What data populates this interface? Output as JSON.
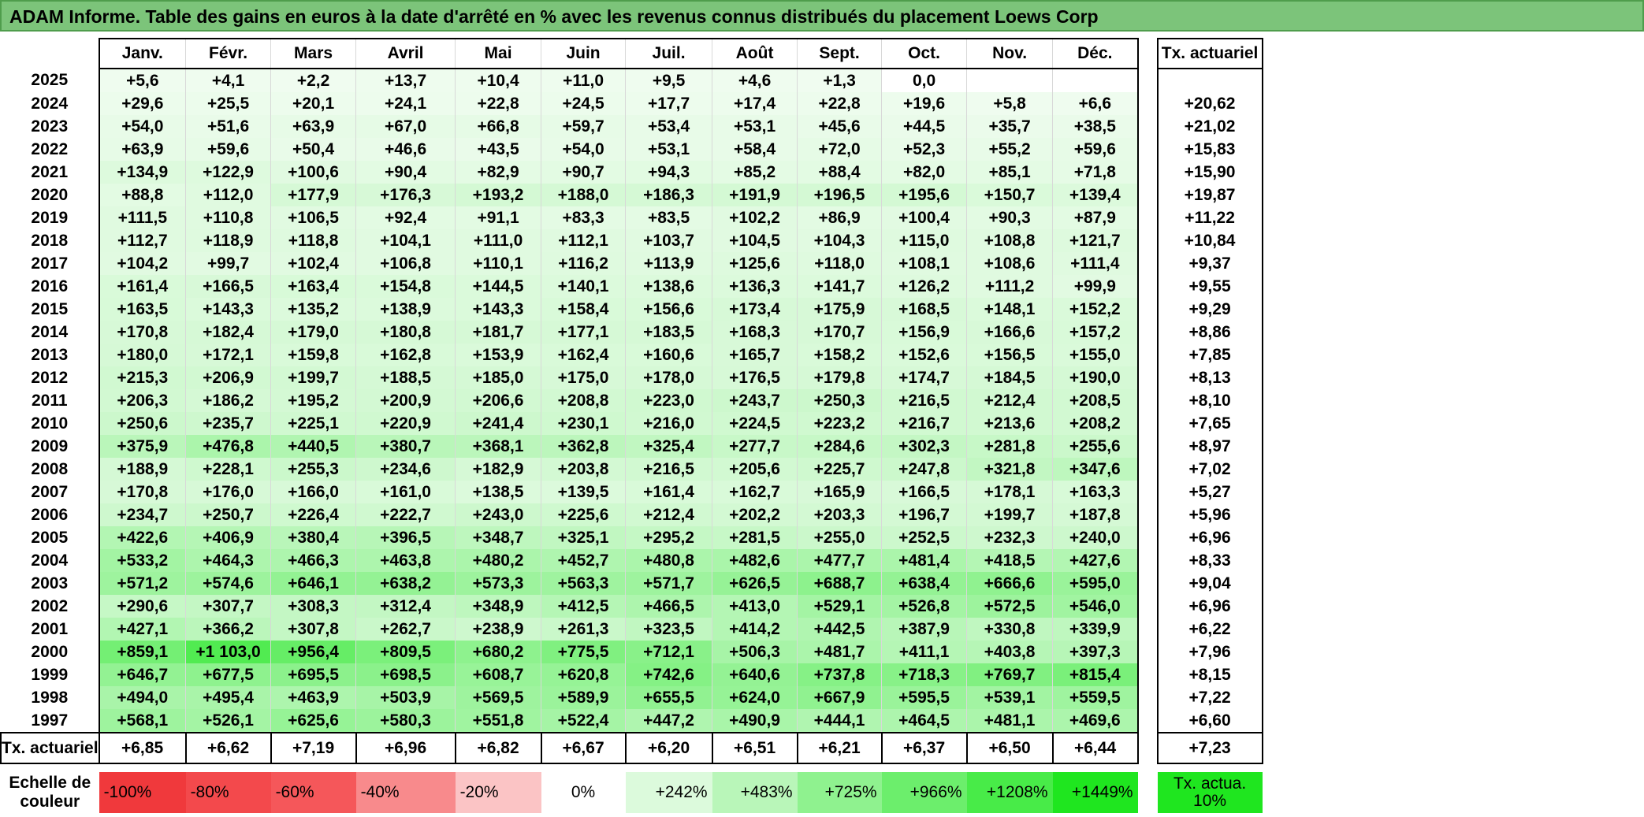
{
  "title": "ADAM Informe. Table des gains en euros à la date d'arrêté en % avec les revenus connus distribués du placement Loews Corp",
  "months": [
    "Janv.",
    "Févr.",
    "Mars",
    "Avril",
    "Mai",
    "Juin",
    "Juil.",
    "Août",
    "Sept.",
    "Oct.",
    "Nov.",
    "Déc."
  ],
  "actuarial_header": "Tx. actuariel",
  "rows": [
    {
      "year": "2025",
      "values": [
        "+5,6",
        "+4,1",
        "+2,2",
        "+13,7",
        "+10,4",
        "+11,0",
        "+9,5",
        "+4,6",
        "+1,3",
        "0,0",
        "",
        ""
      ],
      "actuarial": ""
    },
    {
      "year": "2024",
      "values": [
        "+29,6",
        "+25,5",
        "+20,1",
        "+24,1",
        "+22,8",
        "+24,5",
        "+17,7",
        "+17,4",
        "+22,8",
        "+19,6",
        "+5,8",
        "+6,6"
      ],
      "actuarial": "+20,62"
    },
    {
      "year": "2023",
      "values": [
        "+54,0",
        "+51,6",
        "+63,9",
        "+67,0",
        "+66,8",
        "+59,7",
        "+53,4",
        "+53,1",
        "+45,6",
        "+44,5",
        "+35,7",
        "+38,5"
      ],
      "actuarial": "+21,02"
    },
    {
      "year": "2022",
      "values": [
        "+63,9",
        "+59,6",
        "+50,4",
        "+46,6",
        "+43,5",
        "+54,0",
        "+53,1",
        "+58,4",
        "+72,0",
        "+52,3",
        "+55,2",
        "+59,6"
      ],
      "actuarial": "+15,83"
    },
    {
      "year": "2021",
      "values": [
        "+134,9",
        "+122,9",
        "+100,6",
        "+90,4",
        "+82,9",
        "+90,7",
        "+94,3",
        "+85,2",
        "+88,4",
        "+82,0",
        "+85,1",
        "+71,8"
      ],
      "actuarial": "+15,90"
    },
    {
      "year": "2020",
      "values": [
        "+88,8",
        "+112,0",
        "+177,9",
        "+176,3",
        "+193,2",
        "+188,0",
        "+186,3",
        "+191,9",
        "+196,5",
        "+195,6",
        "+150,7",
        "+139,4"
      ],
      "actuarial": "+19,87"
    },
    {
      "year": "2019",
      "values": [
        "+111,5",
        "+110,8",
        "+106,5",
        "+92,4",
        "+91,1",
        "+83,3",
        "+83,5",
        "+102,2",
        "+86,9",
        "+100,4",
        "+90,3",
        "+87,9"
      ],
      "actuarial": "+11,22"
    },
    {
      "year": "2018",
      "values": [
        "+112,7",
        "+118,9",
        "+118,8",
        "+104,1",
        "+111,0",
        "+112,1",
        "+103,7",
        "+104,5",
        "+104,3",
        "+115,0",
        "+108,8",
        "+121,7"
      ],
      "actuarial": "+10,84"
    },
    {
      "year": "2017",
      "values": [
        "+104,2",
        "+99,7",
        "+102,4",
        "+106,8",
        "+110,1",
        "+116,2",
        "+113,9",
        "+125,6",
        "+118,0",
        "+108,1",
        "+108,6",
        "+111,4"
      ],
      "actuarial": "+9,37"
    },
    {
      "year": "2016",
      "values": [
        "+161,4",
        "+166,5",
        "+163,4",
        "+154,8",
        "+144,5",
        "+140,1",
        "+138,6",
        "+136,3",
        "+141,7",
        "+126,2",
        "+111,2",
        "+99,9"
      ],
      "actuarial": "+9,55"
    },
    {
      "year": "2015",
      "values": [
        "+163,5",
        "+143,3",
        "+135,2",
        "+138,9",
        "+143,3",
        "+158,4",
        "+156,6",
        "+173,4",
        "+175,9",
        "+168,5",
        "+148,1",
        "+152,2"
      ],
      "actuarial": "+9,29"
    },
    {
      "year": "2014",
      "values": [
        "+170,8",
        "+182,4",
        "+179,0",
        "+180,8",
        "+181,7",
        "+177,1",
        "+183,5",
        "+168,3",
        "+170,7",
        "+156,9",
        "+166,6",
        "+157,2"
      ],
      "actuarial": "+8,86"
    },
    {
      "year": "2013",
      "values": [
        "+180,0",
        "+172,1",
        "+159,8",
        "+162,8",
        "+153,9",
        "+162,4",
        "+160,6",
        "+165,7",
        "+158,2",
        "+152,6",
        "+156,5",
        "+155,0"
      ],
      "actuarial": "+7,85"
    },
    {
      "year": "2012",
      "values": [
        "+215,3",
        "+206,9",
        "+199,7",
        "+188,5",
        "+185,0",
        "+175,0",
        "+178,0",
        "+176,5",
        "+179,8",
        "+174,7",
        "+184,5",
        "+190,0"
      ],
      "actuarial": "+8,13"
    },
    {
      "year": "2011",
      "values": [
        "+206,3",
        "+186,2",
        "+195,2",
        "+200,9",
        "+206,6",
        "+208,8",
        "+223,0",
        "+243,7",
        "+250,3",
        "+216,5",
        "+212,4",
        "+208,5"
      ],
      "actuarial": "+8,10"
    },
    {
      "year": "2010",
      "values": [
        "+250,6",
        "+235,7",
        "+225,1",
        "+220,9",
        "+241,4",
        "+230,1",
        "+216,0",
        "+224,5",
        "+223,2",
        "+216,7",
        "+213,6",
        "+208,2"
      ],
      "actuarial": "+7,65"
    },
    {
      "year": "2009",
      "values": [
        "+375,9",
        "+476,8",
        "+440,5",
        "+380,7",
        "+368,1",
        "+362,8",
        "+325,4",
        "+277,7",
        "+284,6",
        "+302,3",
        "+281,8",
        "+255,6"
      ],
      "actuarial": "+8,97"
    },
    {
      "year": "2008",
      "values": [
        "+188,9",
        "+228,1",
        "+255,3",
        "+234,6",
        "+182,9",
        "+203,8",
        "+216,5",
        "+205,6",
        "+225,7",
        "+247,8",
        "+321,8",
        "+347,6"
      ],
      "actuarial": "+7,02"
    },
    {
      "year": "2007",
      "values": [
        "+170,8",
        "+176,0",
        "+166,0",
        "+161,0",
        "+138,5",
        "+139,5",
        "+161,4",
        "+162,7",
        "+165,9",
        "+166,5",
        "+178,1",
        "+163,3"
      ],
      "actuarial": "+5,27"
    },
    {
      "year": "2006",
      "values": [
        "+234,7",
        "+250,7",
        "+226,4",
        "+222,7",
        "+243,0",
        "+225,6",
        "+212,4",
        "+202,2",
        "+203,3",
        "+196,7",
        "+199,7",
        "+187,8"
      ],
      "actuarial": "+5,96"
    },
    {
      "year": "2005",
      "values": [
        "+422,6",
        "+406,9",
        "+380,4",
        "+396,5",
        "+348,7",
        "+325,1",
        "+295,2",
        "+281,5",
        "+255,0",
        "+252,5",
        "+232,3",
        "+240,0"
      ],
      "actuarial": "+6,96"
    },
    {
      "year": "2004",
      "values": [
        "+533,2",
        "+464,3",
        "+466,3",
        "+463,8",
        "+480,2",
        "+452,7",
        "+480,8",
        "+482,6",
        "+477,7",
        "+481,4",
        "+418,5",
        "+427,6"
      ],
      "actuarial": "+8,33"
    },
    {
      "year": "2003",
      "values": [
        "+571,2",
        "+574,6",
        "+646,1",
        "+638,2",
        "+573,3",
        "+563,3",
        "+571,7",
        "+626,5",
        "+688,7",
        "+638,4",
        "+666,6",
        "+595,0"
      ],
      "actuarial": "+9,04"
    },
    {
      "year": "2002",
      "values": [
        "+290,6",
        "+307,7",
        "+308,3",
        "+312,4",
        "+348,9",
        "+412,5",
        "+466,5",
        "+413,0",
        "+529,1",
        "+526,8",
        "+572,5",
        "+546,0"
      ],
      "actuarial": "+6,96"
    },
    {
      "year": "2001",
      "values": [
        "+427,1",
        "+366,2",
        "+307,8",
        "+262,7",
        "+238,9",
        "+261,3",
        "+323,5",
        "+414,2",
        "+442,5",
        "+387,9",
        "+330,8",
        "+339,9"
      ],
      "actuarial": "+6,22"
    },
    {
      "year": "2000",
      "values": [
        "+859,1",
        "+1 103,0",
        "+956,4",
        "+809,5",
        "+680,2",
        "+775,5",
        "+712,1",
        "+506,3",
        "+481,7",
        "+411,1",
        "+403,8",
        "+397,3"
      ],
      "actuarial": "+7,96"
    },
    {
      "year": "1999",
      "values": [
        "+646,7",
        "+677,5",
        "+695,5",
        "+698,5",
        "+608,7",
        "+620,8",
        "+742,6",
        "+640,6",
        "+737,8",
        "+718,3",
        "+769,7",
        "+815,4"
      ],
      "actuarial": "+8,15"
    },
    {
      "year": "1998",
      "values": [
        "+494,0",
        "+495,4",
        "+463,9",
        "+503,9",
        "+569,5",
        "+589,9",
        "+655,5",
        "+624,0",
        "+667,9",
        "+595,5",
        "+539,1",
        "+559,5"
      ],
      "actuarial": "+7,22"
    },
    {
      "year": "1997",
      "values": [
        "+568,1",
        "+526,1",
        "+625,6",
        "+580,3",
        "+551,8",
        "+522,4",
        "+447,2",
        "+490,9",
        "+444,1",
        "+464,5",
        "+481,1",
        "+469,6"
      ],
      "actuarial": "+6,60"
    }
  ],
  "footer": {
    "label": "Tx. actuariel",
    "values": [
      "+6,85",
      "+6,62",
      "+7,19",
      "+6,96",
      "+6,82",
      "+6,67",
      "+6,20",
      "+6,51",
      "+6,21",
      "+6,37",
      "+6,50",
      "+6,44"
    ],
    "actuarial": "+7,23"
  },
  "legend": {
    "label": "Echelle de couleur",
    "items": [
      {
        "text": "-100%",
        "color": "#f0393c"
      },
      {
        "text": "-80%",
        "color": "#f3494c"
      },
      {
        "text": "-60%",
        "color": "#f5575a"
      },
      {
        "text": "-40%",
        "color": "#f88a8c"
      },
      {
        "text": "-20%",
        "color": "#fbc4c5"
      },
      {
        "text": "0%",
        "color": "#ffffff"
      },
      {
        "text": "+242%",
        "color": "#dcfadc"
      },
      {
        "text": "+483%",
        "color": "#b9f6b9"
      },
      {
        "text": "+725%",
        "color": "#8ff28f"
      },
      {
        "text": "+966%",
        "color": "#6cee6c"
      },
      {
        "text": "+1208%",
        "color": "#48eb48"
      },
      {
        "text": "+1449%",
        "color": "#1fe61f"
      }
    ],
    "swatch": {
      "text": "Tx. actua. 10%",
      "color": "#1fe61f"
    }
  }
}
